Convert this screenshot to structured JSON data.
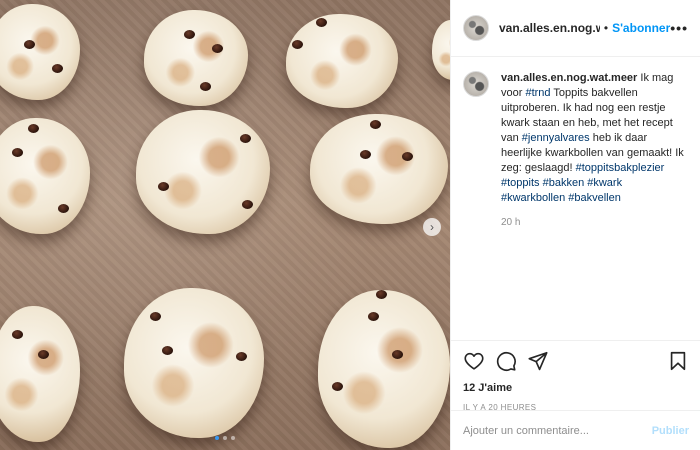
{
  "post": {
    "username": "van.alles.en.nog.wat.meer",
    "separator": "•",
    "follow_label": "S'abonner",
    "more_label": "•••"
  },
  "caption": {
    "username": "van.alles.en.nog.wat.meer",
    "part1": " Ik mag voor ",
    "tag_trnd": "#trnd",
    "part2": " Toppits bakvellen uitproberen. Ik had nog een restje kwark staan en heb, met het recept van ",
    "mention": "#jennyalvares",
    "part3": " heb ik daar heerlijke kwarkbollen van gemaakt! Ik zeg: geslaagd! ",
    "tags": [
      "#toppitsbakplezier",
      "#toppits",
      "#bakken",
      "#kwark",
      "#kwarkbollen",
      "#bakvellen"
    ],
    "time_ago": "20 h"
  },
  "actions": {
    "like_icon": "heart-icon",
    "comment_icon": "comment-bubble-icon",
    "share_icon": "paper-plane-icon",
    "save_icon": "bookmark-icon"
  },
  "likes_label": "12 J'aime",
  "post_date": "IL Y A 20 HEURES",
  "comment": {
    "placeholder": "Ajouter un commentaire...",
    "publish_label": "Publier"
  },
  "carousel": {
    "next_icon": "chevron-right-icon",
    "slide_count": 3,
    "active_index": 0
  },
  "colors": {
    "link": "#00376b",
    "follow": "#0095f6",
    "publish_disabled": "#b2dffc",
    "dot_active": "#3897f0"
  }
}
